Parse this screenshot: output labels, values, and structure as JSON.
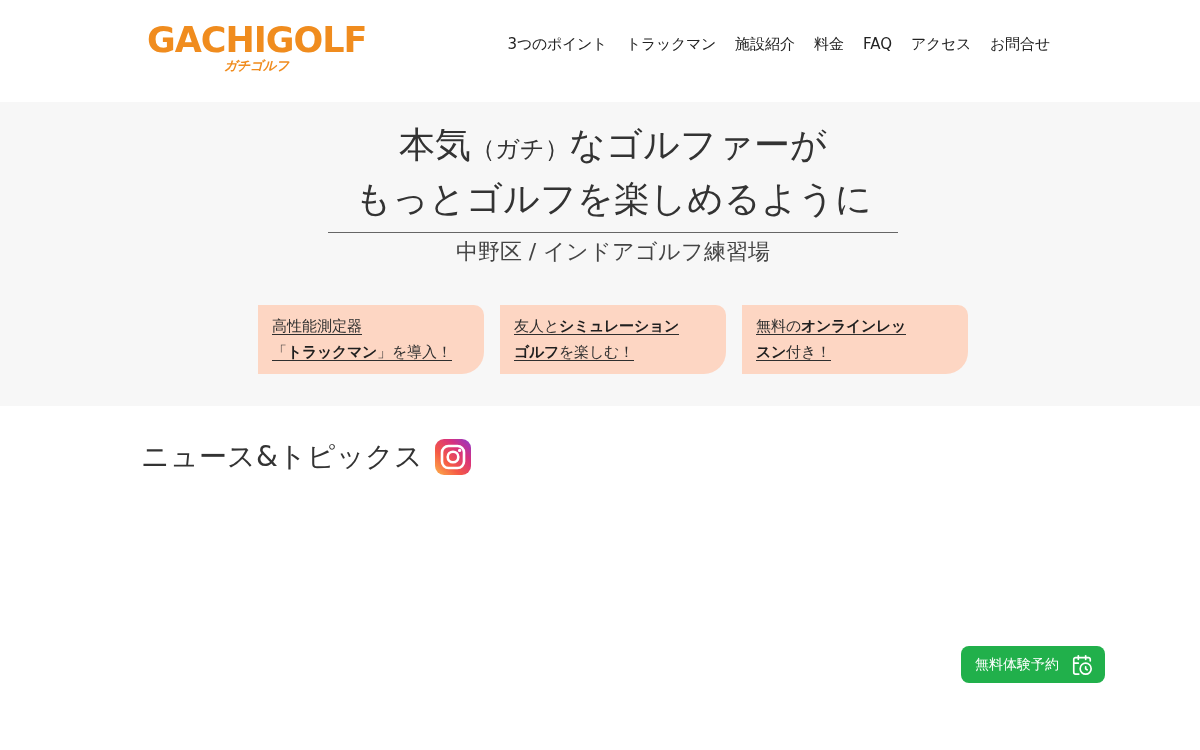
{
  "logo": {
    "wordmark": "GACHIGOLF",
    "reading": "ガチゴルフ"
  },
  "nav": [
    {
      "label": "3つのポイント"
    },
    {
      "label": "トラックマン"
    },
    {
      "label": "施設紹介"
    },
    {
      "label": "料金"
    },
    {
      "label": "FAQ"
    },
    {
      "label": "アクセス"
    },
    {
      "label": "お問合せ"
    }
  ],
  "hero": {
    "headline": [
      [
        {
          "text": "本気",
          "kind": "large"
        },
        {
          "text": "（ガチ）",
          "kind": "small"
        },
        {
          "text": "なゴルファーが",
          "kind": "large"
        }
      ],
      [
        {
          "text": "もっとゴルフを楽しめるように",
          "kind": "large"
        }
      ]
    ],
    "subtitle": "中野区 / インドアゴルフ練習場",
    "features": [
      {
        "lines": [
          "高性能測定器",
          "「**トラックマン**」を導入！"
        ]
      },
      {
        "lines": [
          "友人と**シミュレーション**",
          "**ゴルフ**を楽しむ！"
        ]
      },
      {
        "lines": [
          "無料の**オンラインレッ**",
          "**スン**付き！"
        ]
      }
    ]
  },
  "news": {
    "heading": "ニュース&トピックス"
  },
  "reserve_button": {
    "label": "無料体験予約"
  }
}
